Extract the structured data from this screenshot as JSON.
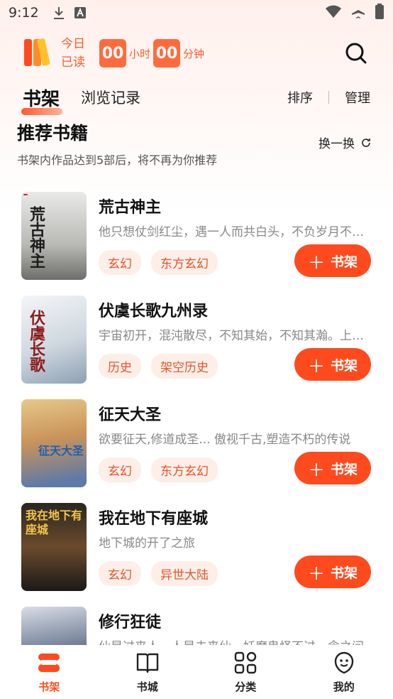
{
  "status": {
    "time": "9:12"
  },
  "header": {
    "read_label_1": "今日",
    "read_label_2": "已读",
    "hours": "00",
    "hours_unit": "小时",
    "minutes": "00",
    "minutes_unit": "分钟"
  },
  "tabs": {
    "active": "书架",
    "history": "浏览记录",
    "sort": "排序",
    "manage": "管理"
  },
  "recommend": {
    "title": "推荐书籍",
    "subtitle": "书架内作品达到5部后，将不再为你推荐",
    "refresh": "换一换"
  },
  "add_label": "书架",
  "books": [
    {
      "title": "荒古神主",
      "desc": "他只想仗剑红尘，遇一人而共白头，不负岁月不负卿。",
      "tags": [
        "玄幻",
        "东方玄幻"
      ],
      "cover_text": "荒古神主"
    },
    {
      "title": "伏虞长歌九州录",
      "desc": "宇宙初开，混沌散尽，不知其始，不知其瀚。上古之时",
      "tags": [
        "历史",
        "架空历史"
      ],
      "cover_text": "伏虞长歌"
    },
    {
      "title": "征天大圣",
      "desc": "欲要征天,修道成圣... 傲视千古,塑造不朽的传说",
      "tags": [
        "玄幻",
        "东方玄幻"
      ],
      "cover_text": "征天大圣"
    },
    {
      "title": "我在地下有座城",
      "desc": "地下城的开了之旅",
      "tags": [
        "玄幻",
        "异世大陆"
      ],
      "cover_text": "我在地下有座城"
    },
    {
      "title": "修行狂徒",
      "desc": "仙是过来人，人是未来仙。妖魔鬼怪不过一念之间",
      "tags": [],
      "cover_text": ""
    }
  ],
  "nav": [
    {
      "label": "书架"
    },
    {
      "label": "书城"
    },
    {
      "label": "分类"
    },
    {
      "label": "我的"
    }
  ],
  "colors": {
    "accent": "#ff4a1e",
    "tag_bg": "#fdeee8"
  }
}
